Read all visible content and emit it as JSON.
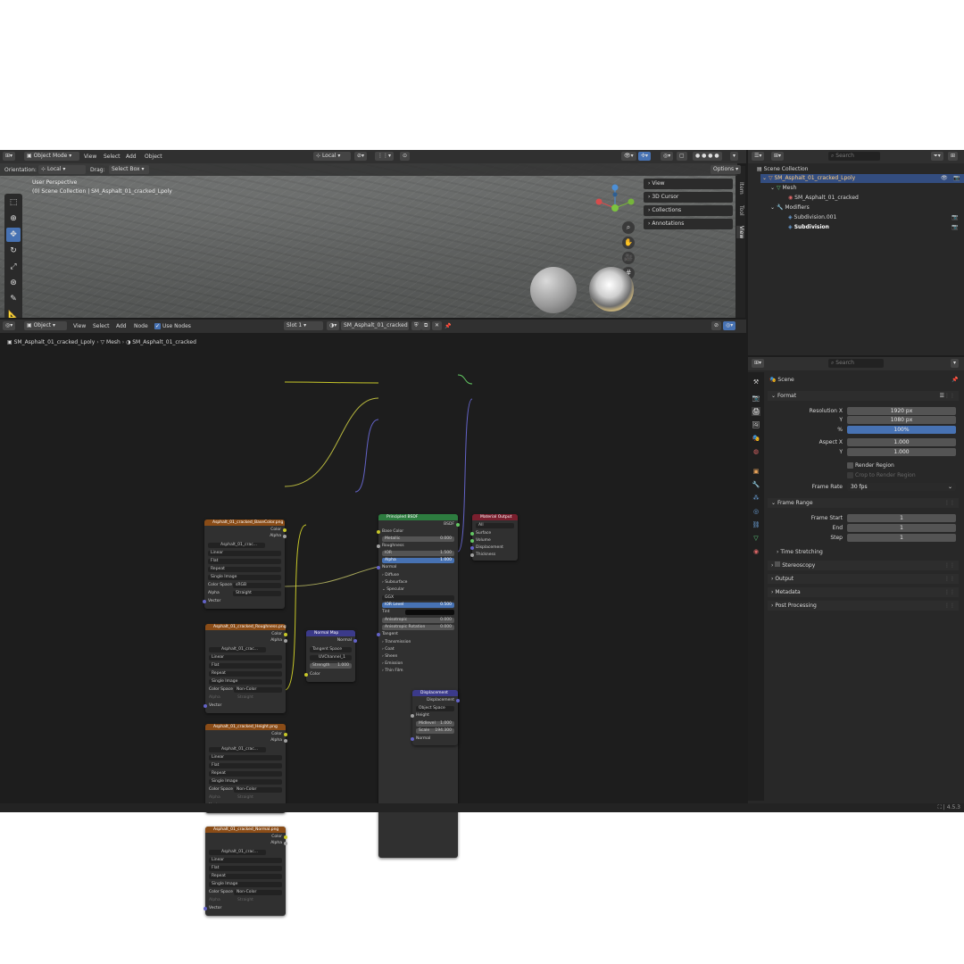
{
  "top_header": {
    "mode": "Object Mode",
    "menus": [
      "View",
      "Select",
      "Add",
      "Object"
    ],
    "transform_space": "Local",
    "orientation_label": "Orientation:",
    "orientation_value": "Local",
    "drag_label": "Drag:",
    "drag_value": "Select Box",
    "options": "Options"
  },
  "viewport": {
    "perspective": "User Perspective",
    "collection": "(0) Scene Collection | SM_Asphalt_01_cracked_Lpoly",
    "npanel": [
      "View",
      "3D Cursor",
      "Collections",
      "Annotations"
    ],
    "tabs": [
      "Item",
      "Tool",
      "View"
    ]
  },
  "node_header": {
    "type": "Object",
    "menus": [
      "View",
      "Select",
      "Add",
      "Node"
    ],
    "use_nodes": "Use Nodes",
    "slot": "Slot 1",
    "material": "SM_Asphalt_01_cracked"
  },
  "breadcrumb": [
    "SM_Asphalt_01_cracked_Lpoly",
    "Mesh",
    "SM_Asphalt_01_cracked"
  ],
  "nodes": {
    "basecolor": {
      "title": "Asphalt_01_cracked_BaseColor.png",
      "outputs": [
        "Color",
        "Alpha"
      ],
      "image": "Asphalt_01_crac...",
      "interp": "Linear",
      "proj": "Flat",
      "ext": "Repeat",
      "src": "Single Image",
      "cs_label": "Color Space",
      "cs": "sRGB",
      "alpha_label": "Alpha",
      "alpha": "Straight",
      "vector": "Vector"
    },
    "roughness": {
      "title": "Asphalt_01_cracked_Roughness.png",
      "outputs": [
        "Color",
        "Alpha"
      ],
      "image": "Asphalt_01_crac...",
      "interp": "Linear",
      "proj": "Flat",
      "ext": "Repeat",
      "src": "Single Image",
      "cs_label": "Color Space",
      "cs": "Non-Color",
      "alpha_label": "Alpha",
      "alpha": "Straight",
      "vector": "Vector"
    },
    "height": {
      "title": "Asphalt_01_cracked_Height.png",
      "outputs": [
        "Color",
        "Alpha"
      ],
      "image": "Asphalt_01_crac...",
      "interp": "Linear",
      "proj": "Flat",
      "ext": "Repeat",
      "src": "Single Image",
      "cs_label": "Color Space",
      "cs": "Non-Color",
      "alpha_label": "Alpha",
      "alpha": "Straight",
      "vector": "Vector"
    },
    "normal": {
      "title": "Asphalt_01_cracked_Normal.png",
      "outputs": [
        "Color",
        "Alpha"
      ],
      "image": "Asphalt_01_crac...",
      "interp": "Linear",
      "proj": "Flat",
      "ext": "Repeat",
      "src": "Single Image",
      "cs_label": "Color Space",
      "cs": "Non-Color",
      "alpha_label": "Alpha",
      "alpha": "Straight",
      "vector": "Vector"
    },
    "normalmap": {
      "title": "Normal Map",
      "output": "Normal",
      "space": "Tangent Space",
      "uv": "UVChannel_1",
      "strength_label": "Strength",
      "strength": "1.000",
      "color": "Color"
    },
    "bsdf": {
      "title": "Principled BSDF",
      "output": "BSDF",
      "base": "Base Color",
      "metallic_label": "Metallic",
      "metallic": "0.000",
      "roughness": "Roughness",
      "ior_label": "IOR",
      "ior": "1.500",
      "alpha_label": "Alpha",
      "alpha": "1.000",
      "normal": "Normal",
      "diffuse": "Diffuse",
      "subsurface": "Subsurface",
      "specular": "Specular",
      "dist": "GGX",
      "ior_level_label": "IOR Level",
      "ior_level": "0.500",
      "tint": "Tint",
      "aniso_label": "Anisotropic",
      "aniso": "0.000",
      "aniso_rot_label": "Anisotropic Rotation",
      "aniso_rot": "0.000",
      "tangent": "Tangent",
      "transmission": "Transmission",
      "coat": "Coat",
      "sheen": "Sheen",
      "emission": "Emission",
      "thinfilm": "Thin Film"
    },
    "output": {
      "title": "Material Output",
      "target": "All",
      "inputs": [
        "Surface",
        "Volume",
        "Displacement",
        "Thickness"
      ]
    },
    "displacement": {
      "title": "Displacement",
      "output": "Displacement",
      "space": "Object Space",
      "height": "Height",
      "midlevel_label": "Midlevel",
      "midlevel": "1.000",
      "scale_label": "Scale",
      "scale": "194.300",
      "normal": "Normal"
    }
  },
  "outliner": {
    "search": "Search",
    "root": "Scene Collection",
    "items": [
      {
        "label": "SM_Asphalt_01_cracked_Lpoly",
        "selected": true
      },
      {
        "label": "Mesh"
      },
      {
        "label": "SM_Asphalt_01_cracked"
      },
      {
        "label": "Modifiers"
      },
      {
        "label": "Subdivision.001"
      },
      {
        "label": "Subdivision"
      }
    ]
  },
  "properties": {
    "search": "Search",
    "context": "Scene",
    "format": {
      "title": "Format",
      "res_x_label": "Resolution X",
      "res_x": "1920 px",
      "res_y_label": "Y",
      "res_y": "1080 px",
      "pct_label": "%",
      "pct": "100%",
      "aspect_x_label": "Aspect X",
      "aspect_x": "1.000",
      "aspect_y_label": "Y",
      "aspect_y": "1.000",
      "render_region": "Render Region",
      "crop": "Crop to Render Region",
      "fps_label": "Frame Rate",
      "fps": "30 fps"
    },
    "frame_range": {
      "title": "Frame Range",
      "start_label": "Frame Start",
      "start": "1",
      "end_label": "End",
      "end": "1",
      "step_label": "Step",
      "step": "1",
      "time_stretching": "Time Stretching"
    },
    "sections": [
      "Stereoscopy",
      "Output",
      "Metadata",
      "Post Processing"
    ]
  },
  "statusbar": {
    "version": "4.5.3"
  },
  "colors": {
    "accent": "#4772b3",
    "image_node": "#8a4c17",
    "shader_node": "#2d7c3f",
    "output_node": "#7a1f2e",
    "vector_node": "#3b3a8a"
  }
}
